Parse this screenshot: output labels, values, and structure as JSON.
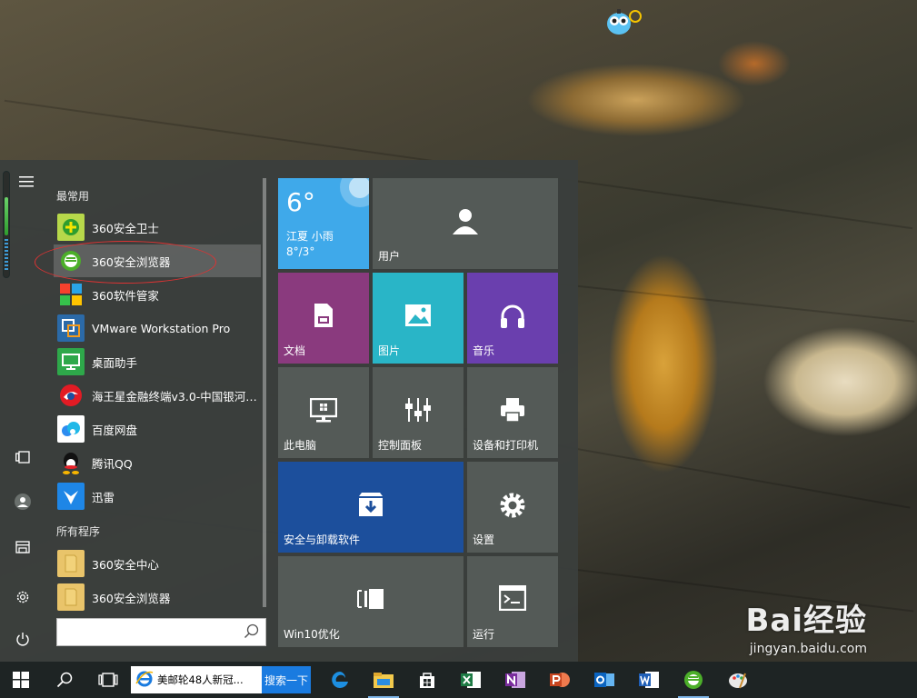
{
  "start_menu": {
    "most_used_title": "最常用",
    "all_programs_title": "所有程序",
    "most_used": [
      {
        "label": "360安全卫士",
        "icon": "360-safeguard-icon"
      },
      {
        "label": "360安全浏览器",
        "icon": "360-browser-icon",
        "highlighted": true
      },
      {
        "label": "360软件管家",
        "icon": "360-software-manager-icon"
      },
      {
        "label": "VMware Workstation Pro",
        "icon": "vmware-icon"
      },
      {
        "label": "桌面助手",
        "icon": "desktop-assistant-icon"
      },
      {
        "label": "海王星金融终端v3.0-中国银河证...",
        "icon": "neptune-finance-icon"
      },
      {
        "label": "百度网盘",
        "icon": "baidu-netdisk-icon"
      },
      {
        "label": "腾讯QQ",
        "icon": "qq-icon"
      },
      {
        "label": "迅雷",
        "icon": "xunlei-icon"
      }
    ],
    "all_programs": [
      {
        "label": "360安全中心",
        "icon": "folder-icon"
      },
      {
        "label": "360安全浏览器",
        "icon": "folder-icon"
      }
    ],
    "search_placeholder": ""
  },
  "tiles": {
    "weather": {
      "temp": "6°",
      "place": "江夏",
      "condition": "小雨",
      "range": "8°/3°"
    },
    "user": "用户",
    "documents": "文档",
    "pictures": "图片",
    "music": "音乐",
    "this_pc": "此电脑",
    "control_panel": "控制面板",
    "devices_printers": "设备和打印机",
    "uninstall": "安全与卸载软件",
    "settings": "设置",
    "win10_optimize": "Win10优化",
    "run": "运行"
  },
  "taskbar": {
    "search_query": "美邮轮48人新冠...",
    "search_button": "搜索一下"
  },
  "watermark": {
    "logo": "Bai经验",
    "url": "jingyan.baidu.com"
  },
  "colors": {
    "weather_tile": "#3fa9ea",
    "documents_tile": "#8a3a7e",
    "pictures_tile": "#29b5c7",
    "music_tile": "#6a3fae",
    "uninstall_tile": "#1c4f9c",
    "gray_tile": "#545a57",
    "taskbar": "#1e2424"
  }
}
